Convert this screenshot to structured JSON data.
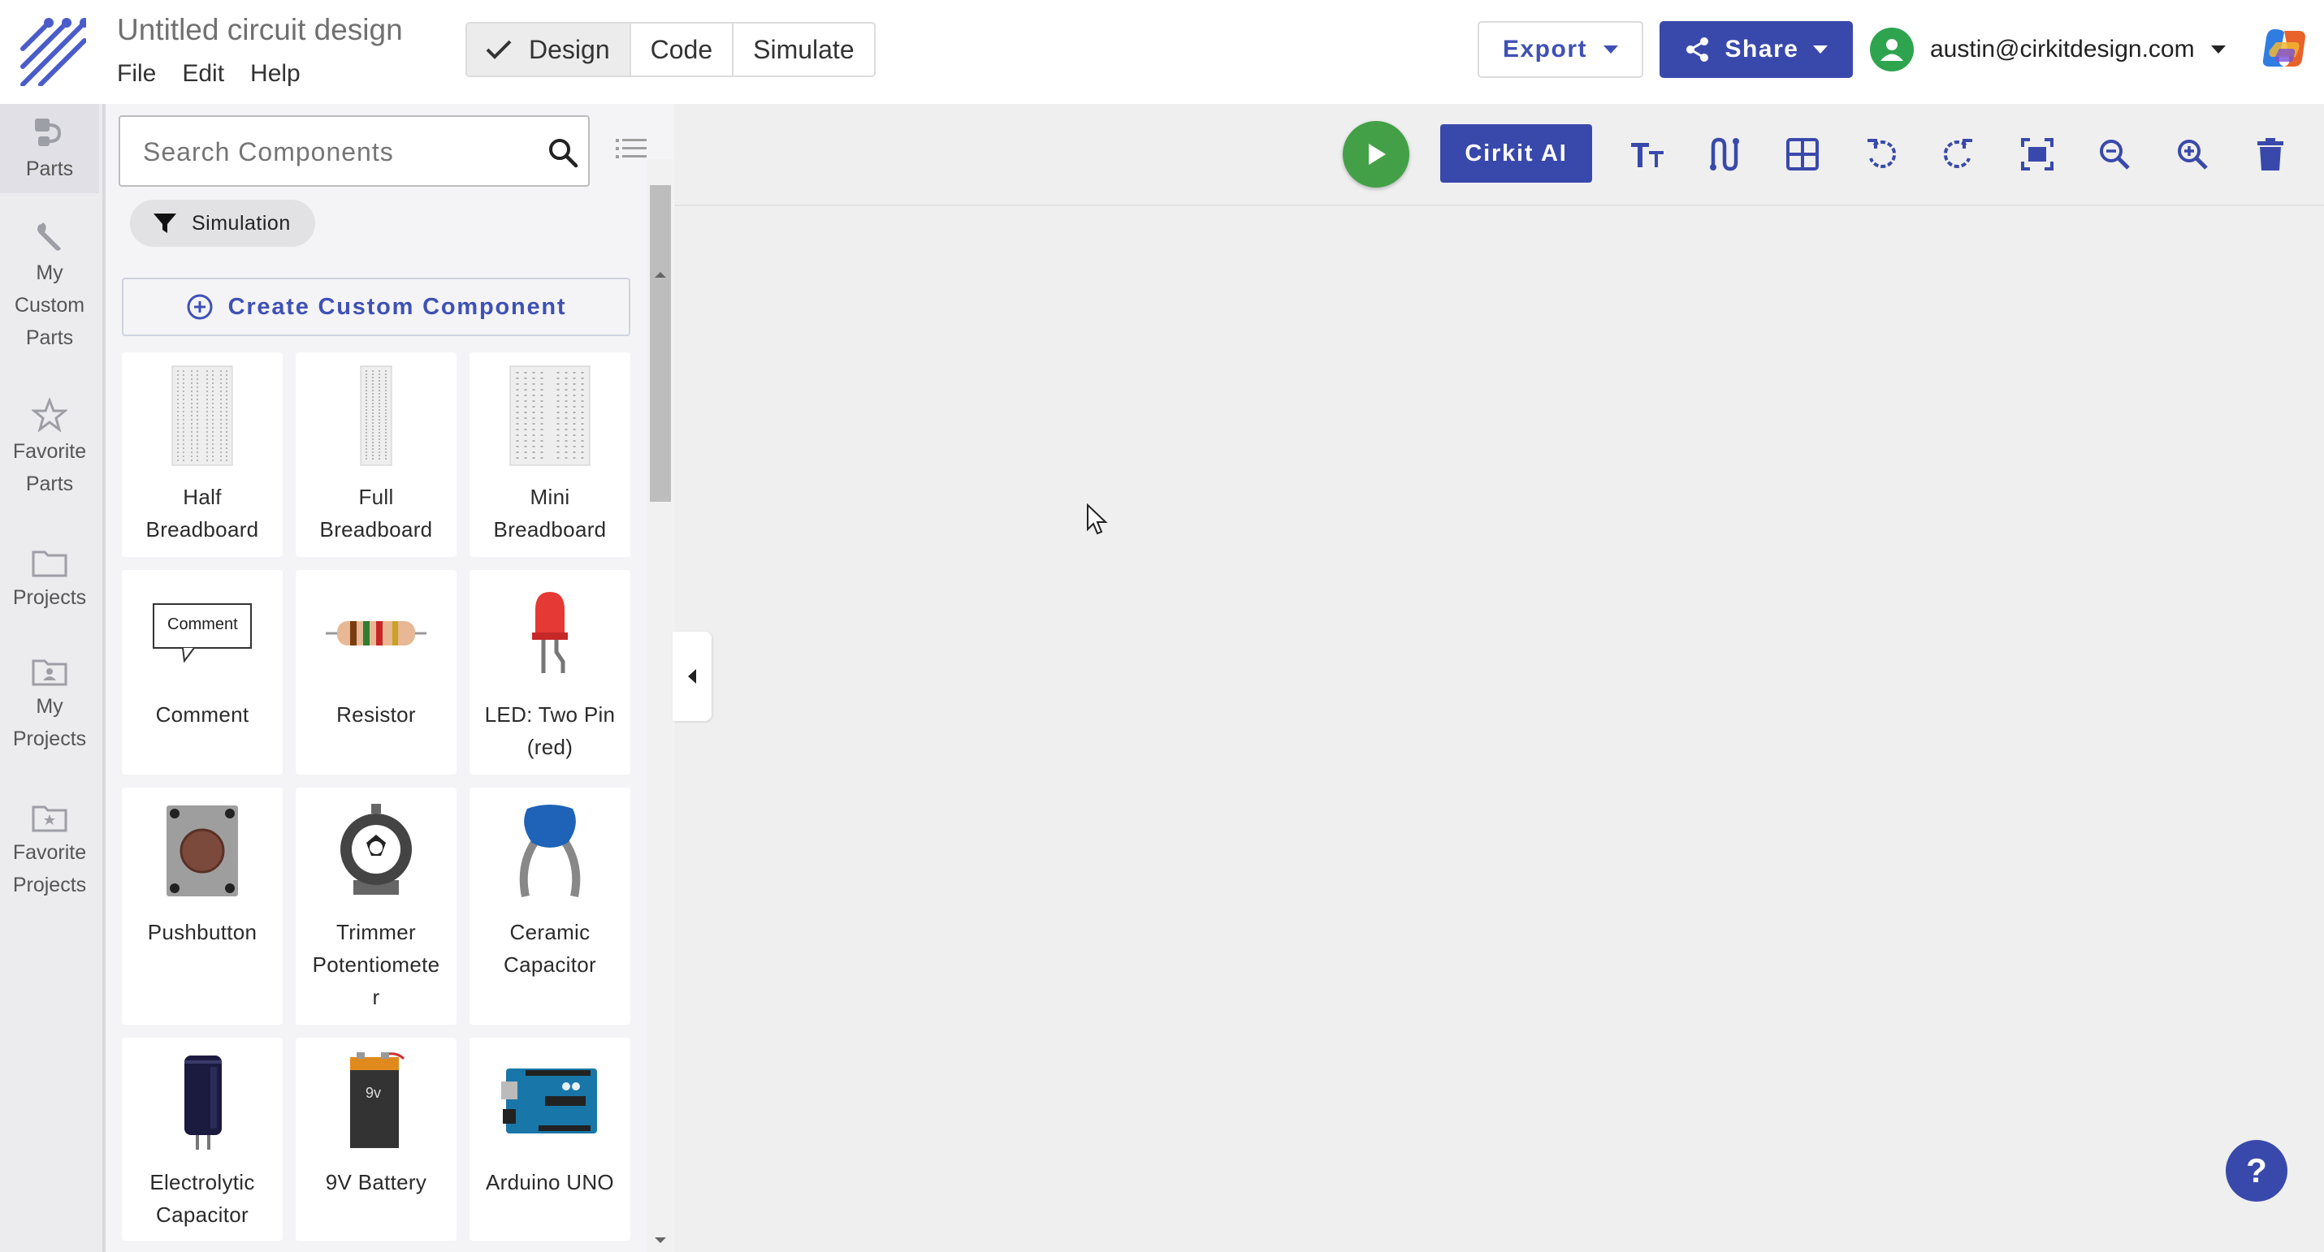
{
  "app": {
    "title": "Untitled circuit design",
    "menus": [
      "File",
      "Edit",
      "Help"
    ],
    "modes": [
      {
        "label": "Design",
        "active": true
      },
      {
        "label": "Code",
        "active": false
      },
      {
        "label": "Simulate",
        "active": false
      }
    ]
  },
  "header": {
    "export_label": "Export",
    "share_label": "Share",
    "user_email": "austin@cirkitdesign.com"
  },
  "rail": {
    "items": [
      {
        "lines": [
          "Parts"
        ],
        "icon": "plug-icon",
        "active": true
      },
      {
        "lines": [
          "My",
          "Custom",
          "Parts"
        ],
        "icon": "wrench-icon",
        "active": false
      },
      {
        "lines": [
          "Favorite",
          "Parts"
        ],
        "icon": "star-icon",
        "active": false
      },
      {
        "lines": [
          "Projects"
        ],
        "icon": "folder-icon",
        "active": false
      },
      {
        "lines": [
          "My",
          "Projects"
        ],
        "icon": "folder-user-icon",
        "active": false
      },
      {
        "lines": [
          "Favorite",
          "Projects"
        ],
        "icon": "folder-star-icon",
        "active": false
      }
    ]
  },
  "panel": {
    "search_placeholder": "Search Components",
    "filter_chip": "Simulation",
    "create_label": "Create Custom Component",
    "parts": [
      {
        "lines": [
          "Half",
          "Breadboard"
        ],
        "icon": "half-breadboard"
      },
      {
        "lines": [
          "Full",
          "Breadboard"
        ],
        "icon": "full-breadboard"
      },
      {
        "lines": [
          "Mini",
          "Breadboard"
        ],
        "icon": "mini-breadboard"
      },
      {
        "lines": [
          "Comment"
        ],
        "icon": "comment",
        "image_text": "Comment"
      },
      {
        "lines": [
          "Resistor"
        ],
        "icon": "resistor"
      },
      {
        "lines": [
          "LED: Two Pin",
          "(red)"
        ],
        "icon": "led-red"
      },
      {
        "lines": [
          "Pushbutton"
        ],
        "icon": "pushbutton"
      },
      {
        "lines": [
          "Trimmer",
          "Potentiomete",
          "r"
        ],
        "icon": "trimmer-potentiometer"
      },
      {
        "lines": [
          "Ceramic",
          "Capacitor"
        ],
        "icon": "ceramic-capacitor"
      },
      {
        "lines": [
          "Electrolytic",
          "Capacitor"
        ],
        "icon": "electrolytic-capacitor"
      },
      {
        "lines": [
          "9V Battery"
        ],
        "icon": "9v-battery",
        "image_text": "9v"
      },
      {
        "lines": [
          "Arduino UNO"
        ],
        "icon": "arduino-uno"
      }
    ]
  },
  "toolbar": {
    "ai_label": "Cirkit AI",
    "tools": [
      "text-icon",
      "wire-icon",
      "grid-icon",
      "rotate-left-icon",
      "rotate-right-icon",
      "fit-screen-icon",
      "zoom-out-icon",
      "zoom-in-icon",
      "delete-icon"
    ]
  },
  "help_label": "?",
  "colors": {
    "primary": "#3949ab",
    "play": "#43a047",
    "avatar": "#2ea44f"
  }
}
